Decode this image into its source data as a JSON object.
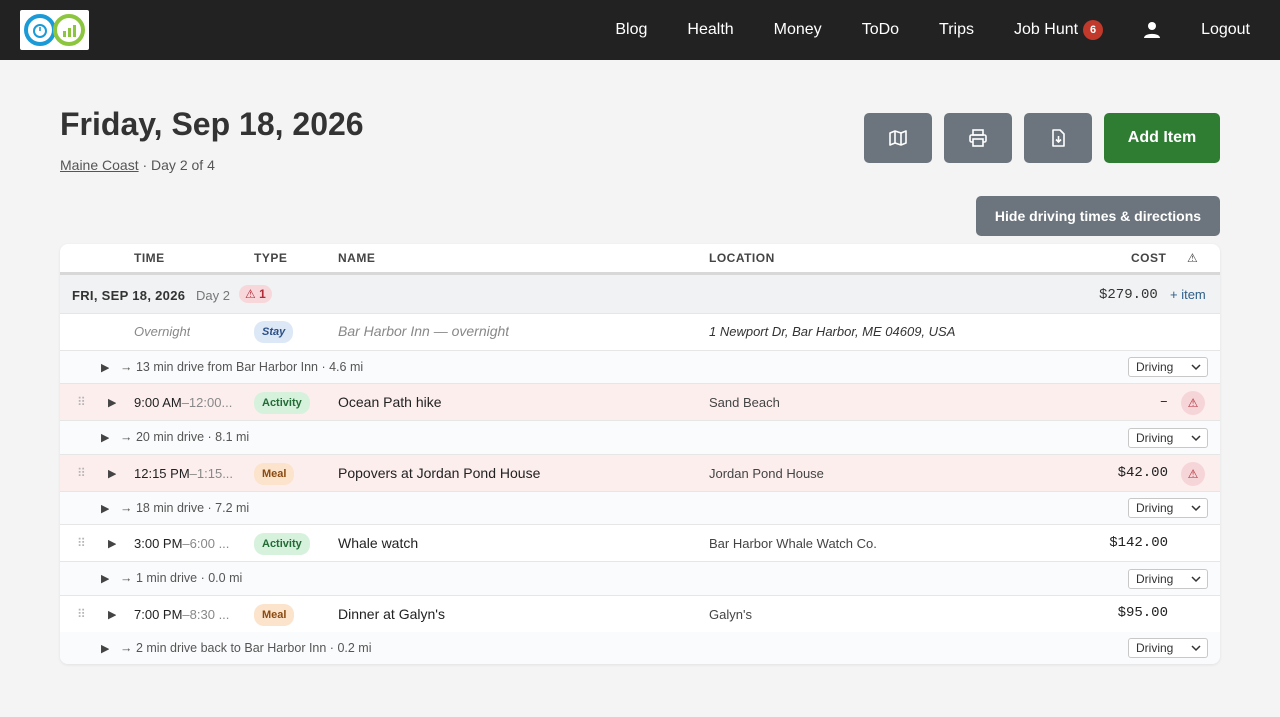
{
  "nav": {
    "items": [
      {
        "label": "Blog"
      },
      {
        "label": "Health"
      },
      {
        "label": "Money"
      },
      {
        "label": "ToDo"
      },
      {
        "label": "Trips"
      },
      {
        "label": "Job Hunt",
        "badge": "6"
      },
      {
        "label": "Logout"
      }
    ]
  },
  "header": {
    "title": "Friday, Sep 18, 2026",
    "trip_name": "Maine Coast",
    "day_info": " · Day 2 of 4",
    "add_item_label": "Add Item",
    "hide_driving_label": "Hide driving times & directions"
  },
  "table": {
    "headers": {
      "time": "TIME",
      "type": "TYPE",
      "name": "NAME",
      "location": "LOCATION",
      "cost": "COST",
      "warn": "⚠"
    },
    "day": {
      "label": "FRI, SEP 18, 2026",
      "day_num": "Day 2",
      "warn_badge": "⚠ 1",
      "total_cost": "$279.00",
      "add_item": "+ item"
    },
    "overnight": {
      "time": "Overnight",
      "type": "Stay",
      "name": "Bar Harbor Inn — overnight",
      "location": "1 Newport Dr, Bar Harbor, ME 04609, USA"
    },
    "items": [
      {
        "start": "9:00 AM",
        "end": "–12:00...",
        "type": "Activity",
        "name": "Ocean Path hike",
        "location": "Sand Beach",
        "cost": "–",
        "warning": true
      },
      {
        "start": "12:15 PM",
        "end": "–1:15...",
        "type": "Meal",
        "name": "Popovers at Jordan Pond House",
        "location": "Jordan Pond House",
        "cost": "$42.00",
        "warning": true
      },
      {
        "start": "3:00 PM",
        "end": "–6:00 ...",
        "type": "Activity",
        "name": "Whale watch",
        "location": "Bar Harbor Whale Watch Co.",
        "cost": "$142.00",
        "warning": false
      },
      {
        "start": "7:00 PM",
        "end": "–8:30 ...",
        "type": "Meal",
        "name": "Dinner at Galyn's",
        "location": "Galyn's",
        "cost": "$95.00",
        "warning": false
      }
    ],
    "drives": [
      {
        "text": "→ 13 min drive from Bar Harbor Inn · 4.6 mi",
        "mode": "Driving"
      },
      {
        "text": "→ 20 min drive · 8.1 mi",
        "mode": "Driving"
      },
      {
        "text": "→ 18 min drive · 7.2 mi",
        "mode": "Driving"
      },
      {
        "text": "→ 1 min drive · 0.0 mi",
        "mode": "Driving"
      },
      {
        "text": "→ 2 min drive back to Bar Harbor Inn · 0.2 mi",
        "mode": "Driving"
      }
    ]
  },
  "colors": {
    "navbar": "#222222",
    "add_button": "#2e7d32",
    "gray_button": "#6c757d",
    "warning": "#b02a37"
  }
}
